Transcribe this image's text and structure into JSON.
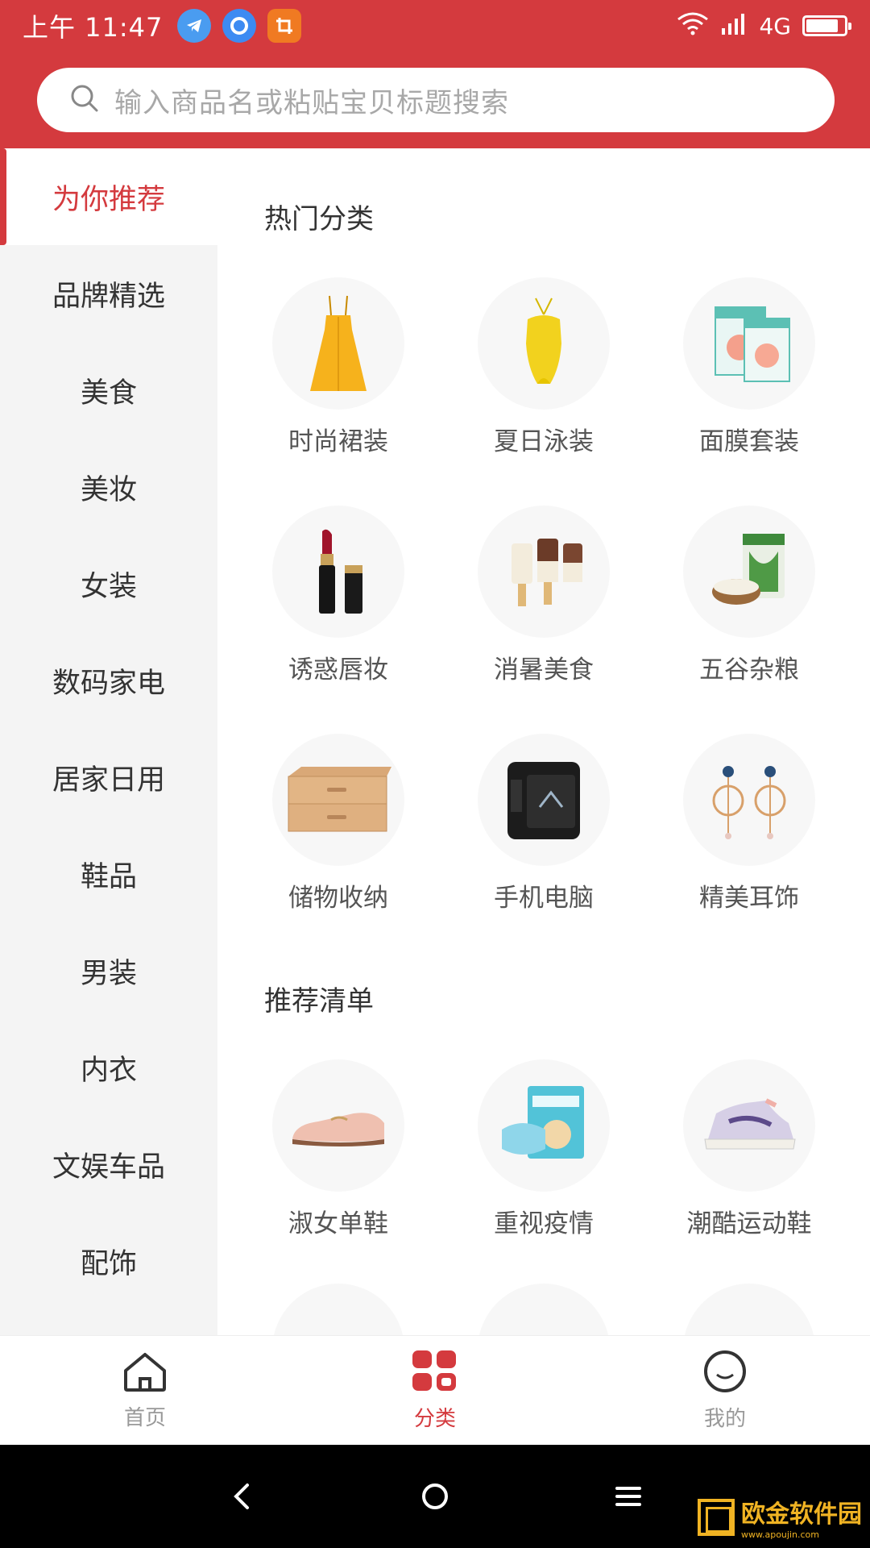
{
  "status_bar": {
    "time": "上午 11:47",
    "network": "4G",
    "battery_level": 0.85,
    "app_icons": [
      "telegram-icon",
      "circle-app-icon",
      "crop-icon"
    ]
  },
  "search": {
    "placeholder": "输入商品名或粘贴宝贝标题搜索"
  },
  "sidebar": {
    "items": [
      {
        "label": "为你推荐",
        "active": true
      },
      {
        "label": "品牌精选"
      },
      {
        "label": "美食"
      },
      {
        "label": "美妆"
      },
      {
        "label": "女装"
      },
      {
        "label": "数码家电"
      },
      {
        "label": "居家日用"
      },
      {
        "label": "鞋品"
      },
      {
        "label": "男装"
      },
      {
        "label": "内衣"
      },
      {
        "label": "文娱车品"
      },
      {
        "label": "配饰"
      }
    ]
  },
  "sections": [
    {
      "title": "热门分类",
      "items": [
        {
          "label": "时尚裙装",
          "icon": "dress-icon"
        },
        {
          "label": "夏日泳装",
          "icon": "swimsuit-icon"
        },
        {
          "label": "面膜套装",
          "icon": "face-mask-box-icon"
        },
        {
          "label": "诱惑唇妆",
          "icon": "lipstick-icon"
        },
        {
          "label": "消暑美食",
          "icon": "popsicle-icon"
        },
        {
          "label": "五谷杂粮",
          "icon": "rice-bag-icon"
        },
        {
          "label": "储物收纳",
          "icon": "drawer-box-icon"
        },
        {
          "label": "手机电脑",
          "icon": "phone-icon"
        },
        {
          "label": "精美耳饰",
          "icon": "earring-icon"
        }
      ]
    },
    {
      "title": "推荐清单",
      "items": [
        {
          "label": "淑女单鞋",
          "icon": "loafer-icon"
        },
        {
          "label": "重视疫情",
          "icon": "medical-mask-icon"
        },
        {
          "label": "潮酷运动鞋",
          "icon": "sneaker-icon"
        }
      ]
    }
  ],
  "tabbar": {
    "items": [
      {
        "label": "首页",
        "icon": "home-icon"
      },
      {
        "label": "分类",
        "icon": "category-grid-icon",
        "active": true
      },
      {
        "label": "我的",
        "icon": "profile-smile-icon"
      }
    ]
  },
  "watermark": {
    "text": "欧金软件园",
    "url": "www.apoujin.com"
  },
  "colors": {
    "brand": "#d43a3e",
    "sidebar_bg": "#f4f4f4"
  }
}
